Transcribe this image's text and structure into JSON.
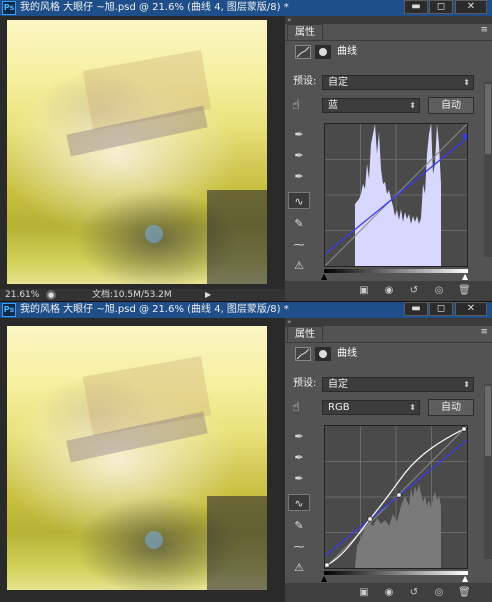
{
  "app_icon": "Ps",
  "windows": [
    {
      "title": "我的风格 大眼仔 ~旭.psd @ 21.6% (曲线 4, 图层蒙版/8) *",
      "status": {
        "zoom": "21.61%",
        "doc": "文档:10.5M/53.2M"
      },
      "panel": {
        "tab": "属性",
        "name": "曲线",
        "preset_label": "预设:",
        "preset": "自定",
        "channel": "蓝",
        "auto_label": "自动"
      }
    },
    {
      "title": "我的风格 大眼仔 ~旭.psd @ 21.6% (曲线 4, 图层蒙版/8) *",
      "panel": {
        "tab": "属性",
        "name": "曲线",
        "preset_label": "预设:",
        "preset": "自定",
        "channel": "RGB",
        "auto_label": "自动"
      }
    }
  ],
  "window_buttons": {
    "minimize": "▬",
    "maximize": "◻",
    "close": "✕"
  },
  "icons": {
    "menu": "≡",
    "collapse": "«",
    "hand": "☝",
    "eyedropper": "✒",
    "curve_tool": "∿",
    "pencil": "✎",
    "smooth": "⁓",
    "warning": "⚠",
    "clip": "▣",
    "eye_prev": "◉",
    "reset": "↺",
    "visibility": "◎",
    "trash": "🗑",
    "play": "▶"
  },
  "colors": {
    "blue_curve": "#3a3af0",
    "histogram_blue": "#d8d8ff",
    "histogram_gray": "#7a7a7a",
    "rgb_curve": "#ffffff"
  }
}
